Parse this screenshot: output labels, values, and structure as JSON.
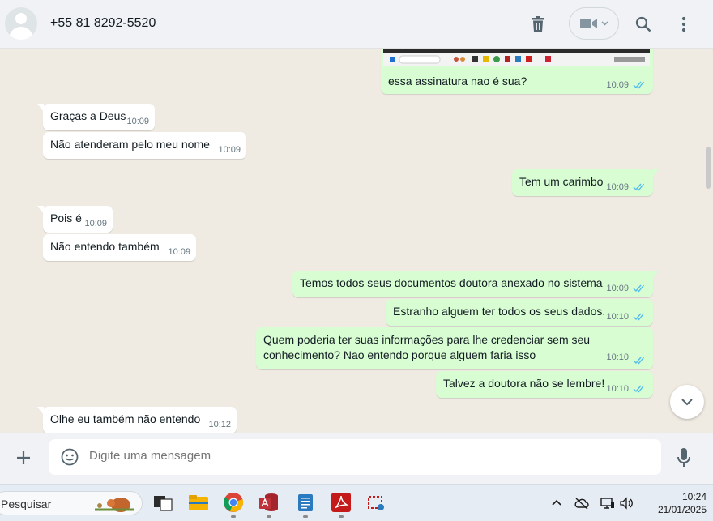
{
  "header": {
    "contact_name": "+55 81 8292-5520",
    "icons": [
      "avatar",
      "trash-icon",
      "video-icon",
      "chevron-down-icon",
      "search-icon",
      "menu-icon"
    ]
  },
  "messages": [
    {
      "id": "m0",
      "direction": "out",
      "text": "essa assinatura nao é sua?",
      "time": "10:09",
      "status": "read"
    },
    {
      "id": "m1",
      "direction": "in",
      "text": "Graças a Deus",
      "time": "10:09"
    },
    {
      "id": "m2",
      "direction": "in",
      "text": "Não atenderam pelo meu nome",
      "time": "10:09"
    },
    {
      "id": "m3",
      "direction": "out",
      "text": "Tem um carimbo",
      "time": "10:09",
      "status": "read"
    },
    {
      "id": "m4",
      "direction": "in",
      "text": "Pois é",
      "time": "10:09"
    },
    {
      "id": "m5",
      "direction": "in",
      "text": "Não entendo também",
      "time": "10:09"
    },
    {
      "id": "m6",
      "direction": "out",
      "text": "Temos todos seus documentos doutora anexado no sistema",
      "time": "10:09",
      "status": "read"
    },
    {
      "id": "m7",
      "direction": "out",
      "text": "Estranho alguem ter todos os seus dados.",
      "time": "10:10",
      "status": "read"
    },
    {
      "id": "m8",
      "direction": "out",
      "text_line1": "Quem poderia ter suas informações para lhe credenciar sem seu",
      "text_line2": "conhecimento? Nao entendo porque alguem faria isso",
      "time": "10:10",
      "status": "read"
    },
    {
      "id": "m9",
      "direction": "out",
      "text": "Talvez a doutora não se lembre!",
      "time": "10:10",
      "status": "read"
    },
    {
      "id": "m10",
      "direction": "in",
      "text": "Olhe eu também não entendo",
      "time": "10:12"
    }
  ],
  "composer": {
    "placeholder": "Digite uma mensagem"
  },
  "taskbar": {
    "search_label": "Pesquisar",
    "time": "10:24",
    "date": "21/01/2025"
  },
  "colors": {
    "outgoing_bubble": "#d9fdd3",
    "incoming_bubble": "#ffffff",
    "chat_background": "#efeae2",
    "read_tick": "#53bdeb"
  }
}
